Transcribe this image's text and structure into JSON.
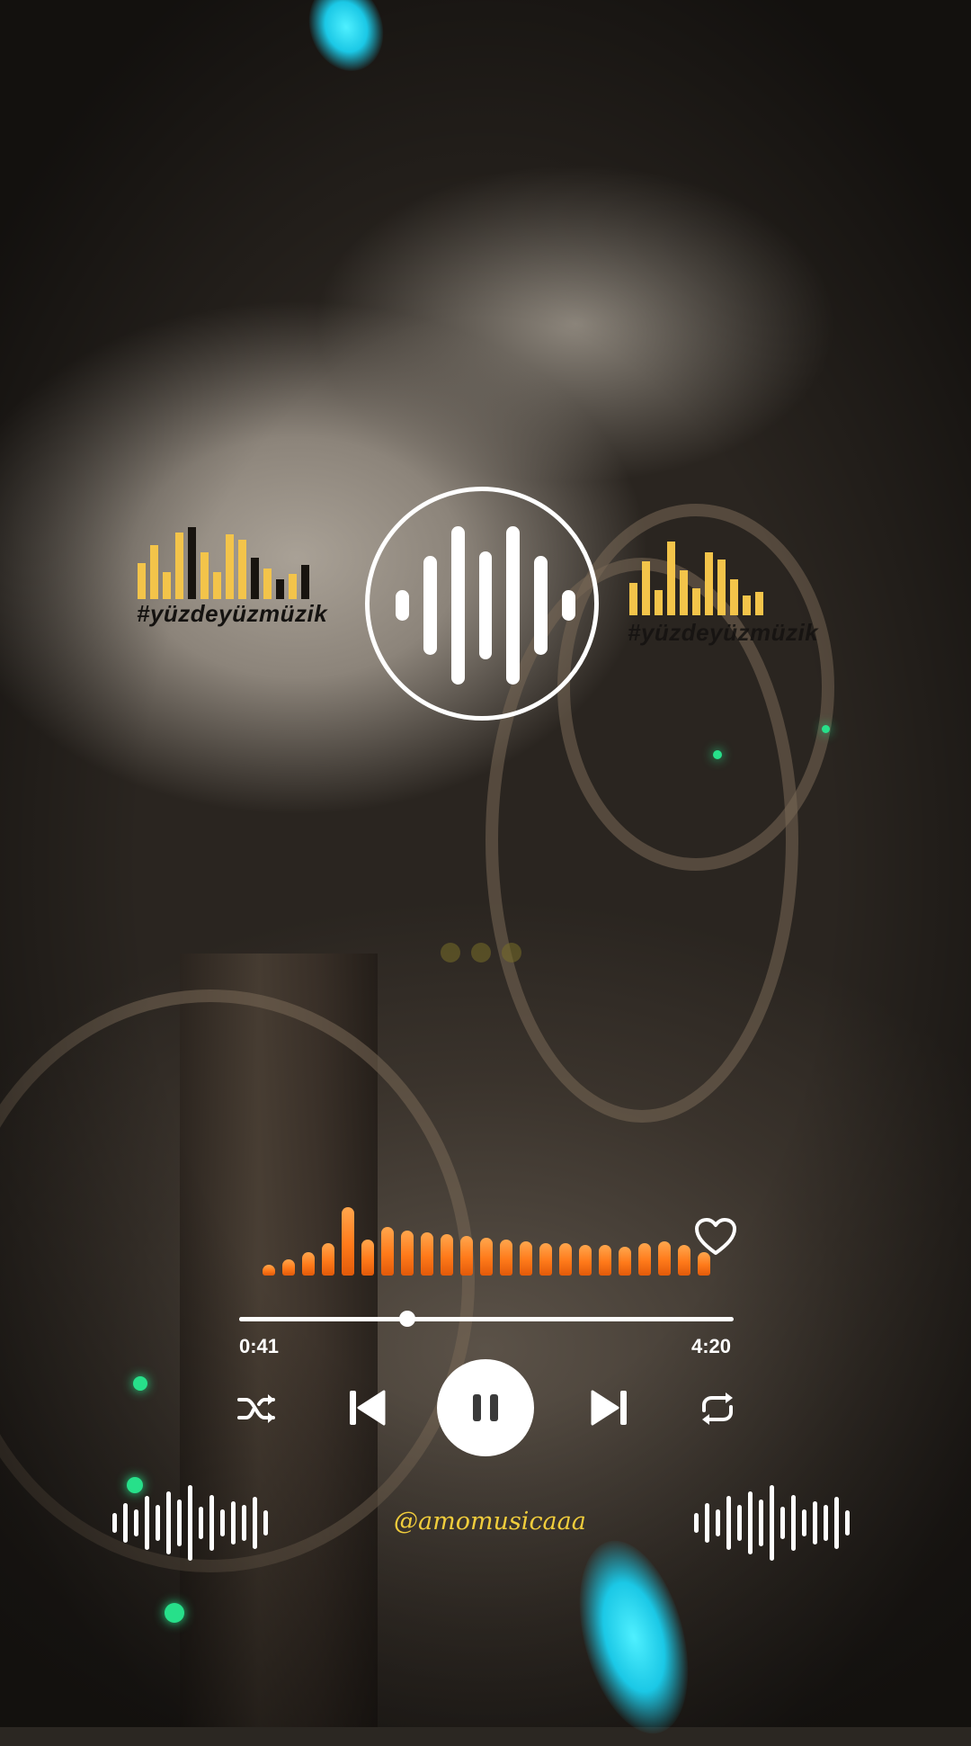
{
  "tags": {
    "left": "#yüzdeyüzmüzik",
    "right": "#yüzdeyüzmüzik"
  },
  "player": {
    "elapsed": "0:41",
    "duration": "4:20",
    "progress": 0.34,
    "is_playing": true,
    "liked": false
  },
  "controls": {
    "shuffle_icon": "shuffle-icon",
    "previous_icon": "skip-previous-icon",
    "pause_icon": "pause-icon",
    "next_icon": "skip-next-icon",
    "repeat_icon": "repeat-icon",
    "like_icon": "heart-icon"
  },
  "footer": {
    "handle": "@amomusicaaa"
  },
  "colors": {
    "accent_orange": "#ff7a1a",
    "eq_yellow": "#f3c44a",
    "handle_yellow": "#f1cd3c",
    "sparkle_cyan": "#1bc8e6",
    "sparkle_green": "#27e08a"
  }
}
